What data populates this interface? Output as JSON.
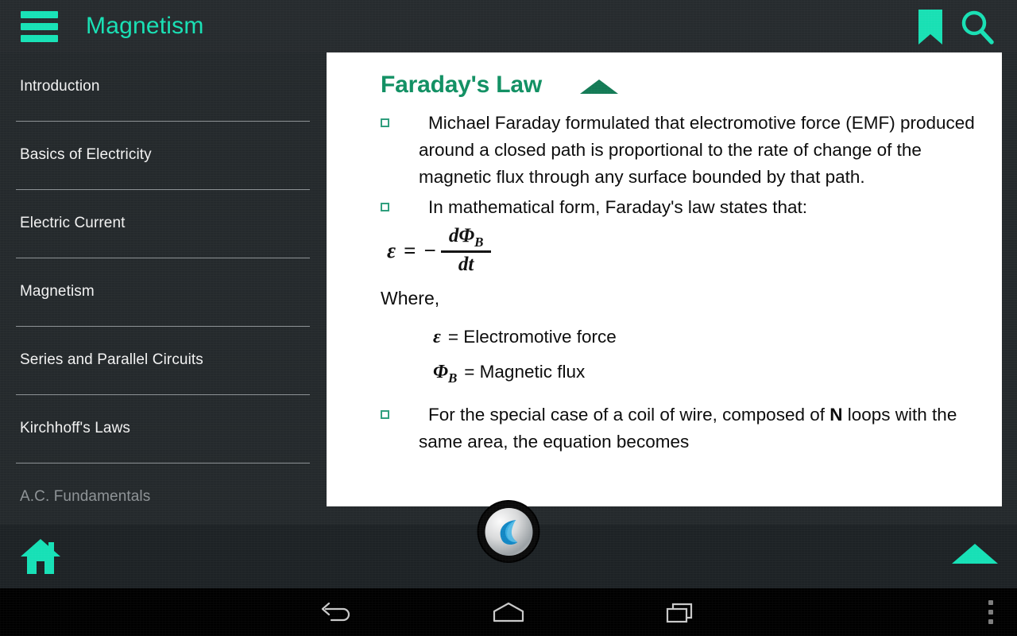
{
  "appbar": {
    "title": "Magnetism",
    "menu_icon": "hamburger-menu-icon",
    "bookmark_icon": "bookmark-icon",
    "search_icon": "search-icon",
    "accent_color": "#18e0b4",
    "background_color": "#262b2e"
  },
  "sidebar": {
    "items": [
      {
        "label": "Introduction"
      },
      {
        "label": "Basics of Electricity"
      },
      {
        "label": "Electric Current"
      },
      {
        "label": "Magnetism"
      },
      {
        "label": "Series and Parallel Circuits"
      },
      {
        "label": "Kirchhoff's Laws"
      },
      {
        "label": "A.C. Fundamentals"
      }
    ]
  },
  "content": {
    "topic_title": "Faraday's Law",
    "topic_title_color": "#119063",
    "collapse_icon": "triangle-up-icon",
    "bullets": [
      {
        "text": "Michael Faraday formulated that electromotive force (EMF) produced around a closed path is proportional to the rate of change of the magnetic flux through any surface bounded by that path."
      },
      {
        "text": "In mathematical form, Faraday's law states that:"
      }
    ],
    "equation": {
      "lhs": "ε",
      "equals": "=",
      "minus": "−",
      "numerator": "dΦ",
      "numerator_sub": "B",
      "denominator": "dt"
    },
    "where_label": "Where,",
    "definitions": [
      {
        "symbol": "ε",
        "symbol_sub": "",
        "text": "= Electromotive force"
      },
      {
        "symbol": "Φ",
        "symbol_sub": "B",
        "text": "= Magnetic flux"
      }
    ],
    "last_bullet": {
      "prefix": "For the special case of a coil of wire, composed of ",
      "bold": "N",
      "suffix": " loops with the same area, the equation becomes"
    }
  },
  "bottombar": {
    "home_icon": "home-icon",
    "logo_icon": "app-logo-icon",
    "scrolltop_icon": "triangle-up-icon",
    "accent_color": "#16e0b6"
  },
  "navbar": {
    "back_icon": "back-arrow-icon",
    "home_icon": "home-pentagon-icon",
    "recents_icon": "recent-apps-icon",
    "overflow_icon": "overflow-menu-icon"
  }
}
